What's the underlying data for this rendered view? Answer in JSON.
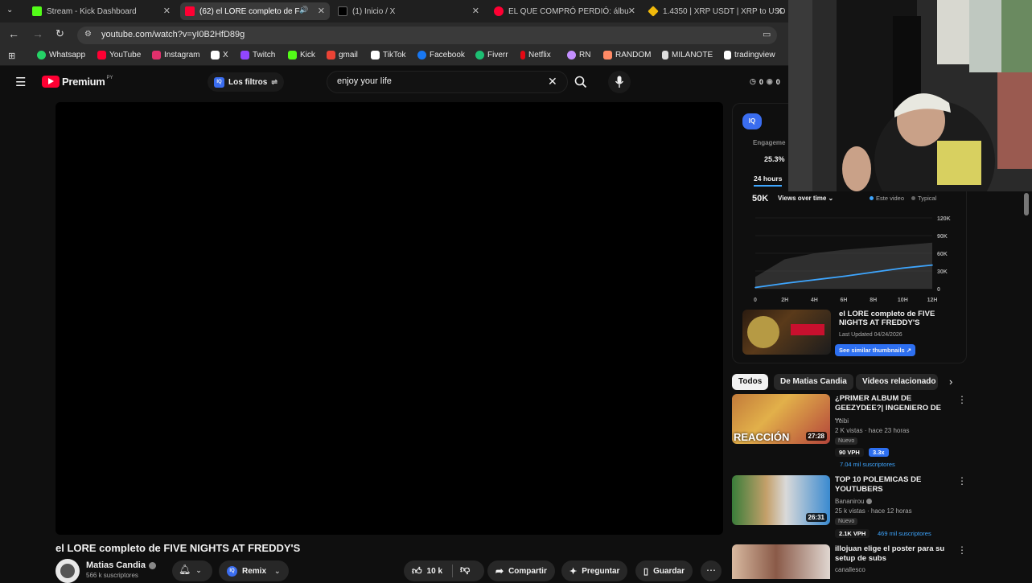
{
  "browser": {
    "tabs": [
      {
        "title": "Stream - Kick Dashboard",
        "active": false,
        "color": "#53fc18"
      },
      {
        "title": "(62) el LORE completo de F",
        "active": true,
        "color": "#ff0033"
      },
      {
        "title": "(1) Inicio / X",
        "active": false,
        "color": "#ffffff"
      },
      {
        "title": "EL QUE COMPRÓ PERDIÓ: álbu",
        "active": false,
        "color": "#ff0033"
      },
      {
        "title": "1.4350 | XRP USDT | XRP to USD",
        "active": false,
        "color": "#f0b90b"
      }
    ],
    "url": "youtube.com/watch?v=yI0B2HfD89g",
    "bookmarks": [
      {
        "label": "Whatsapp",
        "color": "#25d366"
      },
      {
        "label": "YouTube",
        "color": "#ff0033"
      },
      {
        "label": "Instagram",
        "color": "#e1306c"
      },
      {
        "label": "X",
        "color": "#ffffff"
      },
      {
        "label": "Twitch",
        "color": "#9146ff"
      },
      {
        "label": "Kick",
        "color": "#53fc18"
      },
      {
        "label": "gmail",
        "color": "#ea4335"
      },
      {
        "label": "TikTok",
        "color": "#ffffff"
      },
      {
        "label": "Facebook",
        "color": "#1877f2"
      },
      {
        "label": "Fiverr",
        "color": "#1dbf73"
      },
      {
        "label": "Netflix",
        "color": "#e50914"
      },
      {
        "label": "RN",
        "color": "#c38fff"
      },
      {
        "label": "RANDOM",
        "color": "#ff8a65"
      },
      {
        "label": "MILANOTE",
        "color": "#dddddd"
      },
      {
        "label": "tradingview",
        "color": "#ffffff"
      }
    ]
  },
  "youtube": {
    "logo_text": "Premium",
    "country": "PY",
    "filters_label": "Los filtros",
    "search_value": "enjoy your life",
    "counter_a": "0",
    "counter_b": "0",
    "video_title": "el LORE completo de FIVE NIGHTS AT FREDDY'S",
    "channel_name": "Matias Candia",
    "subscribers": "566 k suscriptores",
    "remix_label": "Remix",
    "likes": "10 k",
    "share_label": "Compartir",
    "ask_label": "Preguntar",
    "save_label": "Guardar"
  },
  "iq_panel": {
    "badge": "IQ",
    "engagement_label": "Engageme",
    "engagement_value": "25.3%",
    "period": "24 hours",
    "views_value": "50K",
    "views_label": "Views over time",
    "legend_this": "Este video",
    "legend_typical": "Typical",
    "video_title": "el LORE completo de FIVE NIGHTS AT FREDDY'S",
    "last_updated": "Last Updated 04/24/2026",
    "similar_button": "See similar thumbnails"
  },
  "chart_data": {
    "type": "area",
    "x": [
      "0",
      "2H",
      "4H",
      "6H",
      "8H",
      "10H",
      "12H"
    ],
    "series": [
      {
        "name": "Este video",
        "values": [
          2,
          9,
          15,
          21,
          28,
          35,
          40
        ]
      },
      {
        "name": "Typical",
        "values": [
          20,
          50,
          60,
          66,
          70,
          74,
          78
        ]
      }
    ],
    "yticks": [
      "0",
      "30K",
      "60K",
      "90K",
      "120K"
    ],
    "ylim": [
      0,
      120
    ],
    "colors": {
      "this": "#3ea6ff",
      "typical": "#4a4a4a"
    }
  },
  "chips": [
    "Todos",
    "De Matias Candia",
    "Videos relacionado"
  ],
  "recommendations": [
    {
      "title": "¿PRIMER ALBUM DE GEEZYDEE?| INGENIERO DE ...",
      "channel": "Yeibi",
      "meta": "2 K vistas · hace 23 horas",
      "badge": "Nuevo",
      "vph": "90 VPH",
      "mult": "3.3x",
      "subs": "7.04 mil suscriptores",
      "duration": "27:28",
      "thumb_text": "REACCIÓN"
    },
    {
      "title": "TOP 10 POLEMICAS DE YOUTUBERS",
      "channel": "Bananirou",
      "meta": "25 k vistas · hace 12 horas",
      "badge": "Nuevo",
      "vph": "2.1K VPH",
      "subs": "469 mil suscriptores",
      "duration": "26:31"
    },
    {
      "title": "illojuan elige el poster para su setup de subs",
      "channel": "canallesco"
    }
  ]
}
